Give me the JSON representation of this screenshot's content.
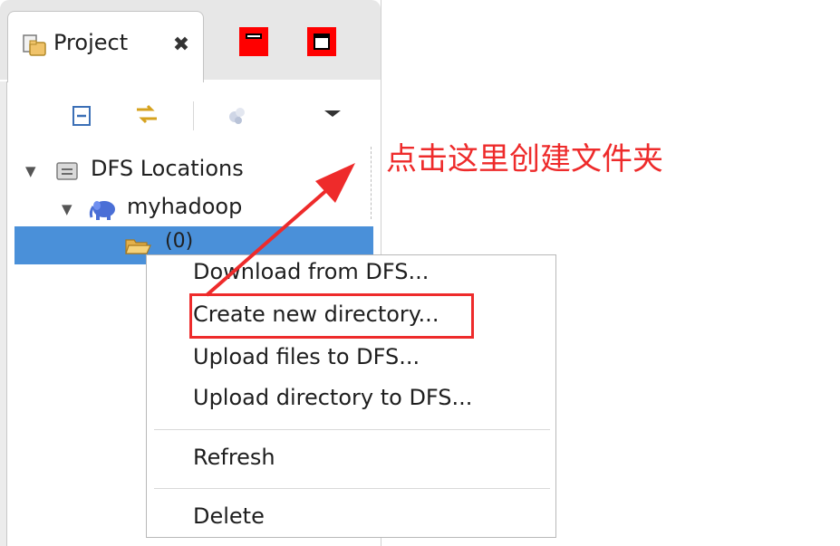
{
  "panel": {
    "tab_label": "Project",
    "tab_close_symbol": "✖"
  },
  "tree": {
    "root_label": "DFS Locations",
    "location_label": "myhadoop",
    "folder_label": "(0)"
  },
  "annotation": {
    "text": "点击这里创建文件夹",
    "color": "#ee2b2b"
  },
  "context_menu": {
    "items": [
      {
        "label": "Download from DFS..."
      },
      {
        "label": "Create new directory..."
      },
      {
        "label": "Upload files to DFS..."
      },
      {
        "label": "Upload directory to DFS..."
      },
      {
        "label": "Refresh"
      },
      {
        "label": "Delete"
      }
    ]
  },
  "colors": {
    "selection": "#4a90d9",
    "window_buttons": "#ff0000",
    "annotation": "#ee2b2b"
  },
  "icons": {
    "tab": "project-icon",
    "collapse": "collapse-all-icon",
    "link": "link-with-editor-icon",
    "filter": "filter-icon",
    "view_menu": "view-menu-icon",
    "root": "dfs-server-icon",
    "location": "elephant-icon",
    "folder": "folder-open-icon"
  }
}
